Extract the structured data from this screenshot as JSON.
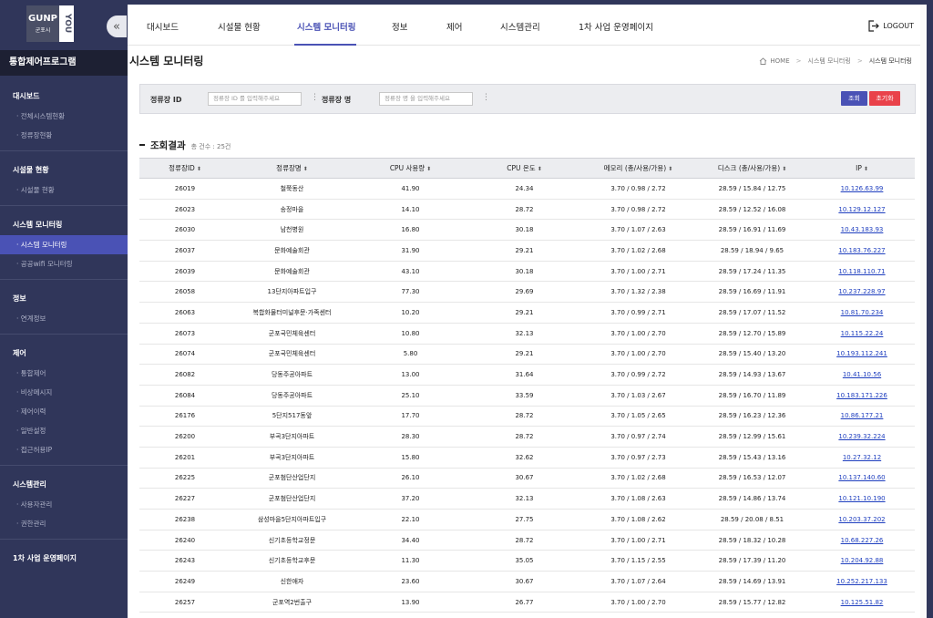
{
  "logo": {
    "main": "GUNP",
    "sub": "군포시",
    "side": "YOU"
  },
  "sidebar": {
    "header": "통합제어프로그램",
    "groups": [
      {
        "title": "대시보드",
        "items": [
          "전체시스템현황",
          "정류장현황"
        ]
      },
      {
        "title": "시설물 현황",
        "items": [
          "시설물 현황"
        ]
      },
      {
        "title": "시스템 모니터링",
        "items": [
          "시스템 모니터링",
          "공공wifi 모니터링"
        ]
      },
      {
        "title": "정보",
        "items": [
          "연계정보"
        ]
      },
      {
        "title": "제어",
        "items": [
          "통합제어",
          "비상메시지",
          "제어이력",
          "일반설정",
          "접근허용IP"
        ]
      },
      {
        "title": "시스템관리",
        "items": [
          "사용자관리",
          "권한관리"
        ]
      },
      {
        "title": "1차 사업 운영페이지",
        "items": []
      }
    ]
  },
  "topnav": {
    "items": [
      "대시보드",
      "시설물 현황",
      "시스템 모니터링",
      "정보",
      "제어",
      "시스템관리",
      "1차 사업 운영페이지"
    ],
    "logout": "LOGOUT"
  },
  "page": {
    "title": "시스템 모니터링",
    "breadcrumb": [
      "HOME",
      "시스템 모니터링",
      "시스템 모니터링"
    ]
  },
  "search": {
    "id_label": "정류장 ID",
    "id_placeholder": "정류장 ID 를 입력해주세요",
    "name_label": "정류장 명",
    "name_placeholder": "정류장 명 을 입력해주세요",
    "search_button": "조회",
    "reset_button": "초기화"
  },
  "results": {
    "title": "조회결과",
    "count": "총 건수 : 25건",
    "columns": [
      "정류장ID",
      "정류장명",
      "CPU 사용량",
      "CPU 온도",
      "메모리 (총/사용/가용)",
      "디스크 (총/사용/가용)",
      "IP"
    ],
    "rows": [
      [
        "26019",
        "철쭉동산",
        "41.90",
        "24.34",
        "3.70 / 0.98 / 2.72",
        "28.59 / 15.84 / 12.75",
        "10.126.63.99"
      ],
      [
        "26023",
        "송정마을",
        "14.10",
        "28.72",
        "3.70 / 0.98 / 2.72",
        "28.59 / 12.52 / 16.08",
        "10.129.12.127"
      ],
      [
        "26030",
        "남천병원",
        "16.80",
        "30.18",
        "3.70 / 1.07 / 2.63",
        "28.59 / 16.91 / 11.69",
        "10.43.183.93"
      ],
      [
        "26037",
        "문화예술회관",
        "31.90",
        "29.21",
        "3.70 / 1.02 / 2.68",
        "28.59 / 18.94 / 9.65",
        "10.183.76.227"
      ],
      [
        "26039",
        "문화예술회관",
        "43.10",
        "30.18",
        "3.70 / 1.00 / 2.71",
        "28.59 / 17.24 / 11.35",
        "10.118.110.71"
      ],
      [
        "26058",
        "13단지아파트입구",
        "77.30",
        "29.69",
        "3.70 / 1.32 / 2.38",
        "28.59 / 16.69 / 11.91",
        "10.237.228.97"
      ],
      [
        "26063",
        "복합화물터미널후문·가족센터",
        "10.20",
        "29.21",
        "3.70 / 0.99 / 2.71",
        "28.59 / 17.07 / 11.52",
        "10.81.70.234"
      ],
      [
        "26073",
        "군포국민체육센터",
        "10.80",
        "32.13",
        "3.70 / 1.00 / 2.70",
        "28.59 / 12.70 / 15.89",
        "10.115.22.24"
      ],
      [
        "26074",
        "군포국민체육센터",
        "5.80",
        "29.21",
        "3.70 / 1.00 / 2.70",
        "28.59 / 15.40 / 13.20",
        "10.193.112.241"
      ],
      [
        "26082",
        "당동주공아파트",
        "13.00",
        "31.64",
        "3.70 / 0.99 / 2.72",
        "28.59 / 14.93 / 13.67",
        "10.41.10.56"
      ],
      [
        "26084",
        "당동주공아파트",
        "25.10",
        "33.59",
        "3.70 / 1.03 / 2.67",
        "28.59 / 16.70 / 11.89",
        "10.183.171.226"
      ],
      [
        "26176",
        "5단지517동앞",
        "17.70",
        "28.72",
        "3.70 / 1.05 / 2.65",
        "28.59 / 16.23 / 12.36",
        "10.86.177.21"
      ],
      [
        "26200",
        "부곡3단지아파트",
        "28.30",
        "28.72",
        "3.70 / 0.97 / 2.74",
        "28.59 / 12.99 / 15.61",
        "10.239.32.224"
      ],
      [
        "26201",
        "부곡3단지아파트",
        "15.80",
        "32.62",
        "3.70 / 0.97 / 2.73",
        "28.59 / 15.43 / 13.16",
        "10.27.32.12"
      ],
      [
        "26225",
        "군포첨단산업단지",
        "26.10",
        "30.67",
        "3.70 / 1.02 / 2.68",
        "28.59 / 16.53 / 12.07",
        "10.137.140.60"
      ],
      [
        "26227",
        "군포첨단산업단지",
        "37.20",
        "32.13",
        "3.70 / 1.08 / 2.63",
        "28.59 / 14.86 / 13.74",
        "10.121.10.190"
      ],
      [
        "26238",
        "삼성마을5단지아파트입구",
        "22.10",
        "27.75",
        "3.70 / 1.08 / 2.62",
        "28.59 / 20.08 / 8.51",
        "10.203.37.202"
      ],
      [
        "26240",
        "신기초등학교정문",
        "34.40",
        "28.72",
        "3.70 / 1.00 / 2.71",
        "28.59 / 18.32 / 10.28",
        "10.68.227.26"
      ],
      [
        "26243",
        "신기초등학교후문",
        "11.30",
        "35.05",
        "3.70 / 1.15 / 2.55",
        "28.59 / 17.39 / 11.20",
        "10.204.92.88"
      ],
      [
        "26249",
        "신한애자",
        "23.60",
        "30.67",
        "3.70 / 1.07 / 2.64",
        "28.59 / 14.69 / 13.91",
        "10.252.217.133"
      ],
      [
        "26257",
        "군포역2번출구",
        "13.90",
        "26.77",
        "3.70 / 1.00 / 2.70",
        "28.59 / 15.77 / 12.82",
        "10.125.51.82"
      ]
    ]
  },
  "colors": {
    "accent": "#4a52b5",
    "sidebar": "#30365a",
    "reset": "#e9424a",
    "link": "#1f3fbf"
  }
}
